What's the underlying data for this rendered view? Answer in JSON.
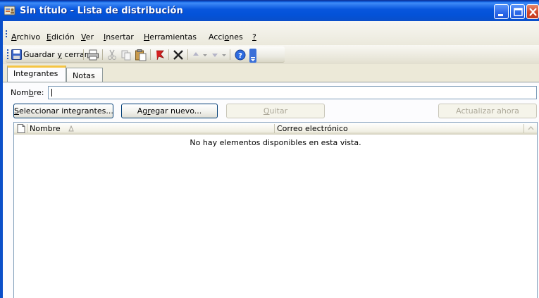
{
  "window": {
    "title": "Sin título - Lista de distribución"
  },
  "menu": {
    "items": [
      {
        "prefix": "",
        "key": "A",
        "rest": "rchivo"
      },
      {
        "prefix": "",
        "key": "E",
        "rest": "dición"
      },
      {
        "prefix": "",
        "key": "V",
        "rest": "er"
      },
      {
        "prefix": "",
        "key": "I",
        "rest": "nsertar"
      },
      {
        "prefix": "",
        "key": "H",
        "rest": "erramientas"
      },
      {
        "prefix": "Acci",
        "key": "o",
        "rest": "nes"
      },
      {
        "prefix": "",
        "key": "?",
        "rest": ""
      }
    ]
  },
  "toolbar": {
    "save_close_prefix": "Guardar ",
    "save_close_key": "y",
    "save_close_rest": " cerrar"
  },
  "tabs": [
    {
      "label": "Integrantes",
      "active": true
    },
    {
      "label": "Notas",
      "active": false
    }
  ],
  "form": {
    "name_label_prefix": "Nom",
    "name_label_key": "b",
    "name_label_rest": "re:",
    "name_value": ""
  },
  "buttons": {
    "select_members_key": "S",
    "select_members_rest": "eleccionar integrantes...",
    "add_new_prefix": "Ag",
    "add_new_key": "r",
    "add_new_rest": "egar nuevo...",
    "remove_key": "Q",
    "remove_rest": "uitar",
    "update_now": "Actualizar ahora"
  },
  "list": {
    "columns": [
      {
        "label": "Nombre"
      },
      {
        "label": "Correo electrónico"
      }
    ],
    "empty_message": "No hay elementos disponibles en esta vista."
  },
  "colors": {
    "titlebar": "#0352d8",
    "close_button": "#d2472a",
    "tab_highlight": "#f5c543"
  }
}
